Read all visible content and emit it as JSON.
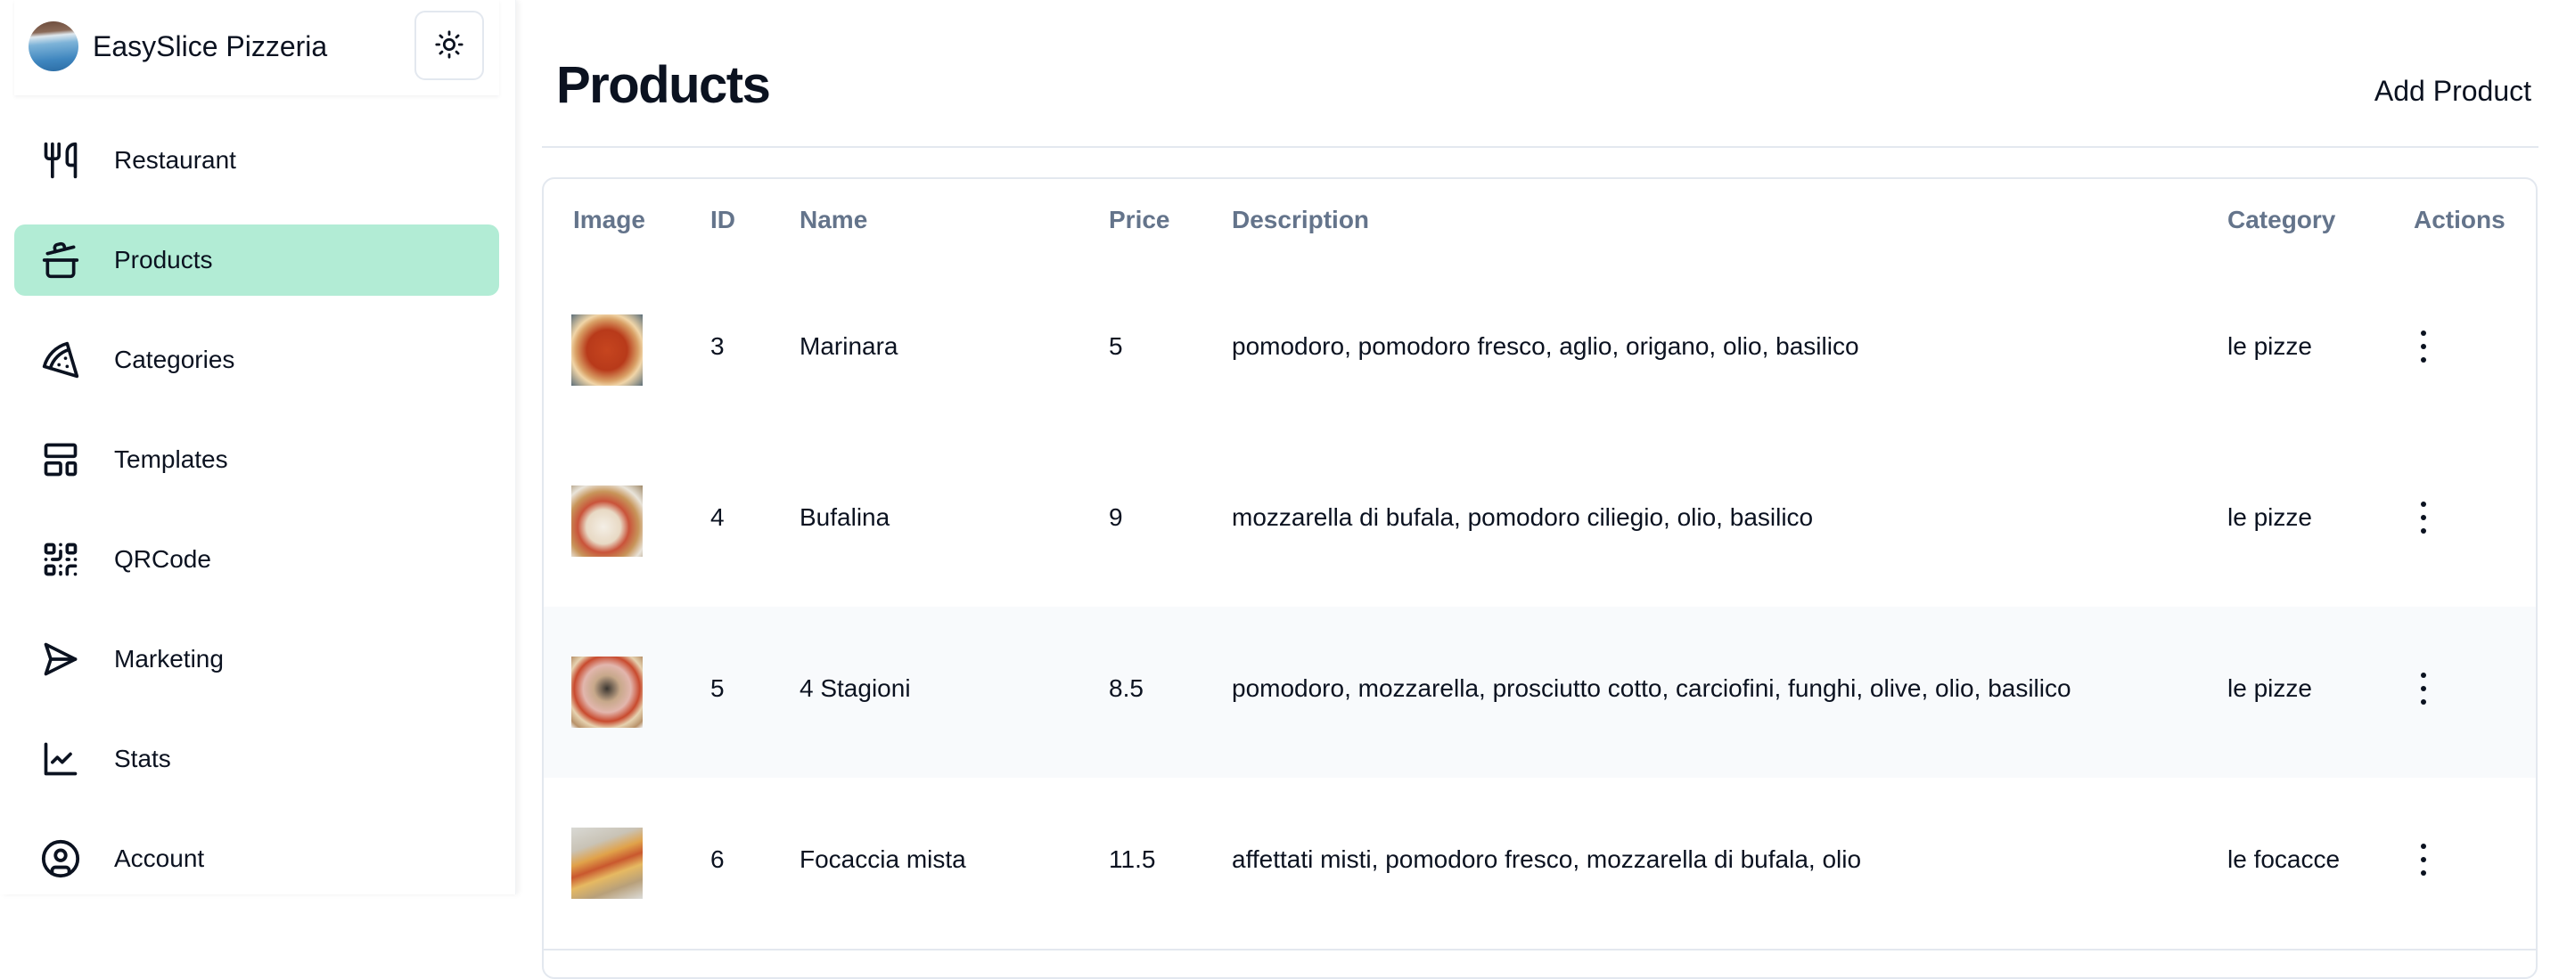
{
  "sidebar": {
    "brand": {
      "name": "EasySlice Pizzeria",
      "avatar_icon": "restaurant-avatar",
      "theme_toggle_icon": "sun-icon"
    },
    "active_color": "#b2ecd5",
    "items": [
      {
        "label": "Restaurant",
        "icon": "fork-knife-icon",
        "active": false
      },
      {
        "label": "Products",
        "icon": "cooking-pot-icon",
        "active": true
      },
      {
        "label": "Categories",
        "icon": "pizza-slice-icon",
        "active": false
      },
      {
        "label": "Templates",
        "icon": "layout-template-icon",
        "active": false
      },
      {
        "label": "QRCode",
        "icon": "qr-code-icon",
        "active": false
      },
      {
        "label": "Marketing",
        "icon": "send-icon",
        "active": false
      },
      {
        "label": "Stats",
        "icon": "line-chart-icon",
        "active": false
      },
      {
        "label": "Account",
        "icon": "user-circle-icon",
        "active": false
      }
    ]
  },
  "main": {
    "title": "Products",
    "add_button_label": "Add Product",
    "table": {
      "columns": [
        "Image",
        "ID",
        "Name",
        "Price",
        "Description",
        "Category",
        "Actions"
      ],
      "rows": [
        {
          "id": "3",
          "name": "Marinara",
          "price": "5",
          "description": "pomodoro, pomodoro fresco, aglio, origano, olio, basilico",
          "category": "le pizze",
          "image": "marinara-thumbnail"
        },
        {
          "id": "4",
          "name": "Bufalina",
          "price": "9",
          "description": "mozzarella di bufala, pomodoro ciliegio, olio, basilico",
          "category": "le pizze",
          "image": "bufalina-thumbnail"
        },
        {
          "id": "5",
          "name": "4 Stagioni",
          "price": "8.5",
          "description": "pomodoro, mozzarella, prosciutto cotto, carciofini, funghi, olive, olio, basilico",
          "category": "le pizze",
          "image": "4-stagioni-thumbnail"
        },
        {
          "id": "6",
          "name": "Focaccia mista",
          "price": "11.5",
          "description": "affettati misti, pomodoro fresco, mozzarella di bufala, olio",
          "category": "le focacce",
          "image": "focaccia-mista-thumbnail"
        }
      ]
    }
  }
}
